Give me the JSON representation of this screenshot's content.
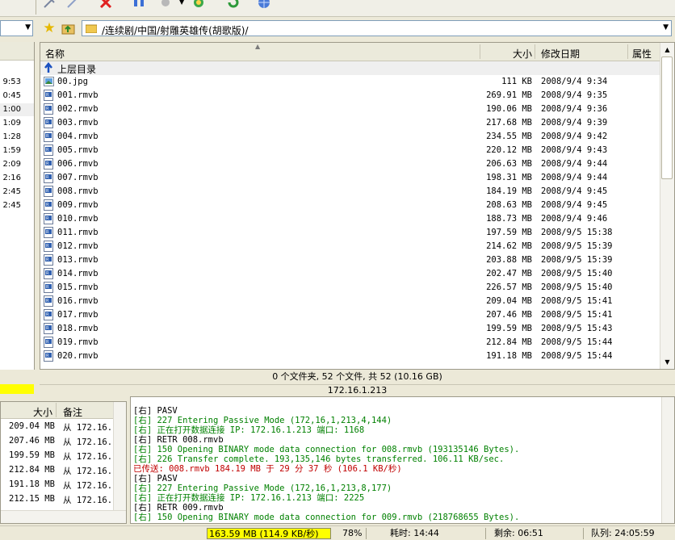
{
  "colors": {
    "yellow": "#ffff00",
    "log_green": "#008000",
    "log_red": "#c00000",
    "highlight": "#efefef"
  },
  "toolbar": {
    "icons": [
      "connect-icon",
      "edit-icon",
      "stop-icon",
      "pause-icon",
      "queue-icon",
      "refresh-icon",
      "globe-icon"
    ]
  },
  "address": {
    "path": "/连续剧/中国/射雕英雄传(胡歌版)/"
  },
  "left_pane": {
    "times": [
      "9:53",
      "0:45",
      "1:00",
      "1:09",
      "1:28",
      "1:59",
      "2:09",
      "2:16",
      "2:45",
      "2:45"
    ]
  },
  "file_list": {
    "columns": {
      "name": "名称",
      "size": "大小",
      "date": "修改日期",
      "attr": "属性"
    },
    "parent_dir": "上层目录",
    "rows": [
      {
        "name": "00.jpg",
        "size": "111 KB",
        "date": "2008/9/4 9:34",
        "icon": "image-file-icon"
      },
      {
        "name": "001.rmvb",
        "size": "269.91 MB",
        "date": "2008/9/4 9:35",
        "icon": "media-file-icon"
      },
      {
        "name": "002.rmvb",
        "size": "190.06 MB",
        "date": "2008/9/4 9:36",
        "icon": "media-file-icon"
      },
      {
        "name": "003.rmvb",
        "size": "217.68 MB",
        "date": "2008/9/4 9:39",
        "icon": "media-file-icon"
      },
      {
        "name": "004.rmvb",
        "size": "234.55 MB",
        "date": "2008/9/4 9:42",
        "icon": "media-file-icon"
      },
      {
        "name": "005.rmvb",
        "size": "220.12 MB",
        "date": "2008/9/4 9:43",
        "icon": "media-file-icon"
      },
      {
        "name": "006.rmvb",
        "size": "206.63 MB",
        "date": "2008/9/4 9:44",
        "icon": "media-file-icon"
      },
      {
        "name": "007.rmvb",
        "size": "198.31 MB",
        "date": "2008/9/4 9:44",
        "icon": "media-file-icon"
      },
      {
        "name": "008.rmvb",
        "size": "184.19 MB",
        "date": "2008/9/4 9:45",
        "icon": "media-file-icon"
      },
      {
        "name": "009.rmvb",
        "size": "208.63 MB",
        "date": "2008/9/4 9:45",
        "icon": "media-file-icon"
      },
      {
        "name": "010.rmvb",
        "size": "188.73 MB",
        "date": "2008/9/4 9:46",
        "icon": "media-file-icon"
      },
      {
        "name": "011.rmvb",
        "size": "197.59 MB",
        "date": "2008/9/5 15:38",
        "icon": "media-file-icon"
      },
      {
        "name": "012.rmvb",
        "size": "214.62 MB",
        "date": "2008/9/5 15:39",
        "icon": "media-file-icon"
      },
      {
        "name": "013.rmvb",
        "size": "203.88 MB",
        "date": "2008/9/5 15:39",
        "icon": "media-file-icon"
      },
      {
        "name": "014.rmvb",
        "size": "202.47 MB",
        "date": "2008/9/5 15:40",
        "icon": "media-file-icon"
      },
      {
        "name": "015.rmvb",
        "size": "226.57 MB",
        "date": "2008/9/5 15:40",
        "icon": "media-file-icon"
      },
      {
        "name": "016.rmvb",
        "size": "209.04 MB",
        "date": "2008/9/5 15:41",
        "icon": "media-file-icon"
      },
      {
        "name": "017.rmvb",
        "size": "207.46 MB",
        "date": "2008/9/5 15:41",
        "icon": "media-file-icon"
      },
      {
        "name": "018.rmvb",
        "size": "199.59 MB",
        "date": "2008/9/5 15:43",
        "icon": "media-file-icon"
      },
      {
        "name": "019.rmvb",
        "size": "212.84 MB",
        "date": "2008/9/5 15:44",
        "icon": "media-file-icon"
      },
      {
        "name": "020.rmvb",
        "size": "191.18 MB",
        "date": "2008/9/5 15:44",
        "icon": "media-file-icon"
      }
    ],
    "summary": "0 个文件夹, 52 个文件, 共 52 (10.16 GB)",
    "server": "172.16.1.213"
  },
  "queue": {
    "columns": {
      "size": "大小",
      "note": "备注"
    },
    "rows": [
      {
        "size": "209.04 MB",
        "note": "从 172.16."
      },
      {
        "size": "207.46 MB",
        "note": "从 172.16."
      },
      {
        "size": "199.59 MB",
        "note": "从 172.16."
      },
      {
        "size": "212.84 MB",
        "note": "从 172.16."
      },
      {
        "size": "191.18 MB",
        "note": "从 172.16."
      },
      {
        "size": "212.15 MB",
        "note": "从 172.16."
      }
    ]
  },
  "log": {
    "lines": [
      {
        "text": "[右] PASV",
        "color": "#000000"
      },
      {
        "text": "[右] 227 Entering Passive Mode (172,16,1,213,4,144)",
        "color": "#008000"
      },
      {
        "text": "[右] 正在打开数据连接 IP: 172.16.1.213 端口: 1168",
        "color": "#008000"
      },
      {
        "text": "[右] RETR 008.rmvb",
        "color": "#000000"
      },
      {
        "text": "[右] 150 Opening BINARY mode data connection for 008.rmvb (193135146 Bytes).",
        "color": "#008000"
      },
      {
        "text": "[右] 226 Transfer complete. 193,135,146 bytes transferred. 106.11 KB/sec.",
        "color": "#008000"
      },
      {
        "text": "已传送: 008.rmvb 184.19 MB 于 29 分 37 秒 (106.1 KB/秒)",
        "color": "#c00000"
      },
      {
        "text": "[右] PASV",
        "color": "#000000"
      },
      {
        "text": "[右] 227 Entering Passive Mode (172,16,1,213,8,177)",
        "color": "#008000"
      },
      {
        "text": "[右] 正在打开数据连接 IP: 172.16.1.213 端口: 2225",
        "color": "#008000"
      },
      {
        "text": "[右] RETR 009.rmvb",
        "color": "#000000"
      },
      {
        "text": "[右] 150 Opening BINARY mode data connection for 009.rmvb (218768655 Bytes).",
        "color": "#008000"
      }
    ]
  },
  "status": {
    "speed": "163.59 MB (114.9 KB/秒)",
    "percent": "78%",
    "elapsed": "耗时: 14:44",
    "remaining": "剩余: 06:51",
    "queue": "队列: 24:05:59"
  }
}
